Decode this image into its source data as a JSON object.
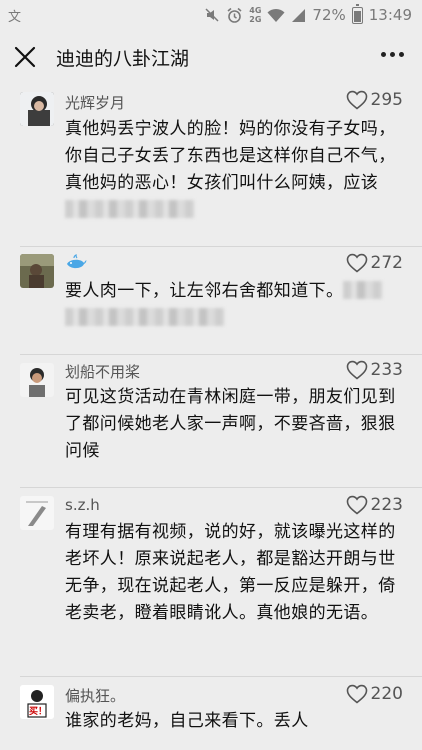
{
  "status_bar": {
    "left_icon": "文",
    "icons": [
      "mute-icon",
      "alarm-icon",
      "wifi-icon",
      "signal-icon"
    ],
    "net_top": "4G",
    "net_bottom": "2G",
    "battery": "72%",
    "battery_level": 0.72,
    "time": "13:49"
  },
  "title_bar": {
    "title": "迪迪的八卦江湖",
    "close_icon": "close-icon",
    "more_icon": "more-icon"
  },
  "comments": [
    {
      "name": "光辉岁月",
      "likes": "295",
      "text": "真他妈丢宁波人的脸！妈的你没有子女吗，你自己子女丢了东西也是这样你自己不气，真他妈的恶心！女孩们叫什么阿姨，应该"
    },
    {
      "name": "",
      "name_icon": "whale-icon",
      "likes": "272",
      "text": "要人肉一下，让左邻右舍都知道下。"
    },
    {
      "name": "划船不用桨",
      "likes": "233",
      "text": "可见这货活动在青林闲庭一带，朋友们见到了都问候她老人家一声啊，不要吝啬，狠狠问候"
    },
    {
      "name": "s.z.h",
      "likes": "223",
      "text": "有理有据有视频，说的好，就该曝光这样的老坏人！原来说起老人，都是豁达开朗与世无争，现在说起老人，第一反应是躲开，倚老卖老，瞪着眼睛讹人。真他娘的无语。"
    },
    {
      "name": "偏执狂。",
      "likes": "220",
      "text": "谁家的老妈，自己来看下。丢人",
      "avatar_text": "买！"
    }
  ]
}
